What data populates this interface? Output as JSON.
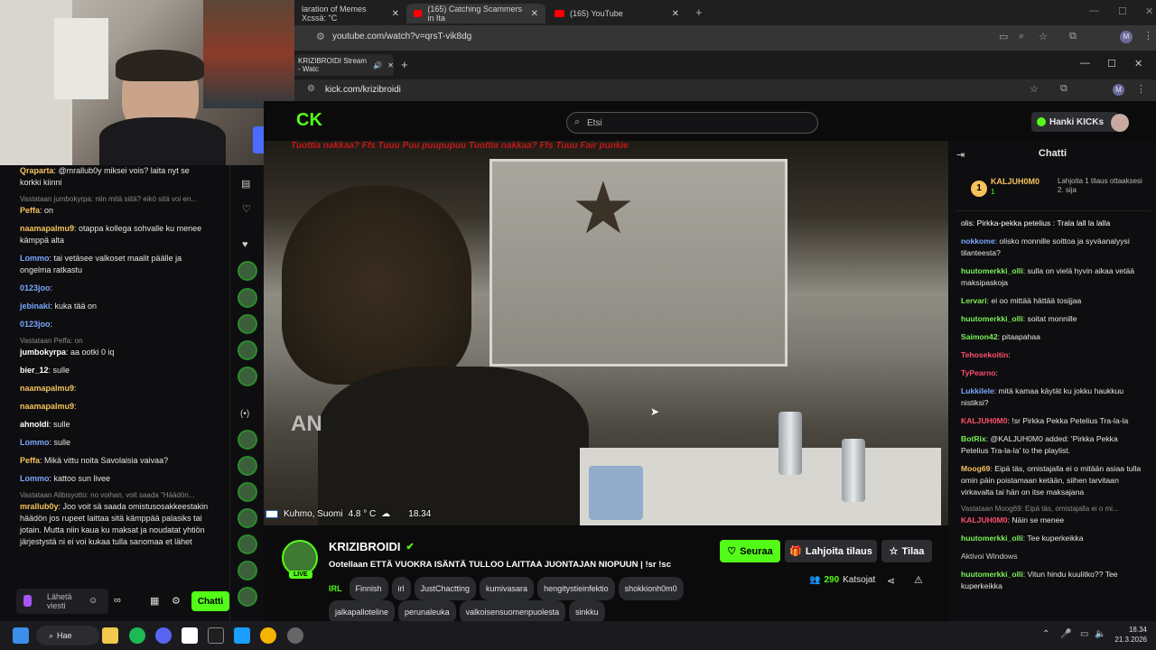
{
  "bg_browser": {
    "tabs": [
      {
        "label": "laration of Memes Xcssä: \"C"
      },
      {
        "label": "(165) Catching Scammers in Ita"
      },
      {
        "label": "(165) YouTube"
      }
    ],
    "url": "youtube.com/watch?v=qrsT-vik8dg"
  },
  "left_chat": {
    "top_msg": {
      "user": "Qraparta",
      "text": ": @mrallub0y miksei vois? laita nyt se korkki kiinni"
    },
    "messages": [
      {
        "reply": "Vastataan jumbokyrpa: niin mitä siitä? eikö sitä voi en...",
        "user": "Peffa",
        "text": ": on",
        "color": "#f5c25b"
      },
      {
        "user": "naamapalmu9",
        "text": ": otappa kollega sohvalle ku menee kämppä alta",
        "color": "#f5c25b"
      },
      {
        "user": "Lommo",
        "text": ": tai vetäsee valkoset maalit päälle ja ongelma ratkastu",
        "color": "#7aa7ff"
      },
      {
        "user": "0123joo",
        "text": ":",
        "color": "#7aa7ff"
      },
      {
        "user": "jebinaki",
        "text": ": kuka tää on",
        "color": "#7aa7ff"
      },
      {
        "user": "0123joo",
        "text": ":",
        "color": "#7aa7ff"
      },
      {
        "reply": "Vastataan Peffa: on",
        "user": "jumbokyrpa",
        "text": ": aa ootki 0 iq",
        "color": "#ffffff"
      },
      {
        "user": "bier_12",
        "text": ": sulle",
        "color": "#ffffff"
      },
      {
        "user": "naamapalmu9",
        "text": ":",
        "color": "#f5c25b"
      },
      {
        "user": "naamapalmu9",
        "text": ":",
        "color": "#f5c25b"
      },
      {
        "user": "ahnoldi",
        "text": ": sulle",
        "color": "#ffffff"
      },
      {
        "user": "Lommo",
        "text": ": sulle",
        "color": "#7aa7ff"
      },
      {
        "user": "Peffa",
        "text": ": Mikä vittu noita Savolaisia vaivaa?",
        "color": "#f5c25b"
      },
      {
        "user": "Lommo",
        "text": ": kattoo sun livee",
        "color": "#7aa7ff"
      },
      {
        "reply": "Vastataan Alibisyotto: no voihan, voit saada \"Häädön...",
        "user": "mrallub0y",
        "text": ": Joo voit sä saada omistusosakkeestakin häädön jos rupeet laittaa sitä kämppää palasiks tai jotain. Mutta niin kaua ku maksat ja noudatat yhtiön järjestystä ni ei voi kukaa tulla sanomaa et lähet",
        "color": "#f5c25b"
      }
    ],
    "input_placeholder": "Lähetä viesti",
    "chat_button": "Chatti"
  },
  "kick": {
    "tab_title": "KRIZIBROIDI Stream - Watc",
    "url": "kick.com/krizibroidi",
    "search_placeholder": "Etsi",
    "get_kicks": "Hanki KICKs",
    "ticker": "Tuottia nakkaa?   Ffs   Tuuu   Puu puupupuu   Tuottia nakkaa?   Ffs   Tuuu   Fair punkie",
    "overlay": {
      "location": "Kuhmo, Suomi",
      "temp": "4.8 ° C",
      "time": "18.34"
    },
    "streamer": "KRIZIBROIDI",
    "live_badge": "LIVE",
    "stream_title": "Ootellaan ETTÄ VUOKRA ISÄNTÄ TULLOO LAITTAA JUONTAJAN NIOPUUN | !sr !sc",
    "category": "IRL",
    "tags": [
      "Finnish",
      "irl",
      "JustChactting",
      "kumivasara",
      "hengitystieinfektio",
      "shokkionh0m0",
      "jalkapalloteline",
      "perunaleuka",
      "valkoisensuomenpuolesta",
      "sinkku"
    ],
    "follow": "Seuraa",
    "gift": "Lahjoita tilaus",
    "subscribe": "Tilaa",
    "viewers": "290",
    "viewers_label": "Katsojat"
  },
  "right_chat": {
    "title": "Chatti",
    "leader": {
      "rank": "1",
      "name": "KALJUH0M0",
      "count": "1",
      "note": "Lahjoita 1 tilaus ottaaksesi 2. sija"
    },
    "messages": [
      {
        "user": "",
        "text": "olis: Pirkka-pekka petelius : Trala lall la lalla",
        "color": "#ffffff"
      },
      {
        "user": "nokkome",
        "text": ": olisko monnille soittoa ja syväanalyysi tilanteesta?",
        "color": "#7aa7ff"
      },
      {
        "user": "huutomerkki_olli",
        "text": ": sulla on vielä hyvin aikaa vetää maksipaskoja",
        "color": "#7cf05a"
      },
      {
        "user": "Lervari",
        "text": ": ei oo mittää hättää tosijjaa",
        "color": "#7cf05a"
      },
      {
        "user": "huutomerkki_olli",
        "text": ": soitat monnille",
        "color": "#7cf05a"
      },
      {
        "user": "Saimon42",
        "text": ": pitaapahaa",
        "color": "#7cf05a"
      },
      {
        "user": "Tehosekoitin",
        "text": ":",
        "color": "#ff4d6d"
      },
      {
        "user": "TyPearno",
        "text": ":",
        "color": "#ff4d6d"
      },
      {
        "user": "Lukkilele",
        "text": ": mitä kamaa käytät ku jokku haukkuu nistiksi?",
        "color": "#7aa7ff"
      },
      {
        "user": "KALJUH0M0",
        "text": ": !sr Pirkka Pekka Petelius Tra-la-la",
        "color": "#ff4d6d"
      },
      {
        "user": "BotRix",
        "text": ": @KALJUH0M0 added: 'Pirkka Pekka Petelius Tra-la-la' to the playlist.",
        "color": "#7cf05a"
      },
      {
        "user": "Moog69",
        "text": ": Eipä täs, omistajalla ei o mitään asiaa tulla omin päin poistamaan ketään, siihen tarvitaan virkavalta tai hän on itse maksajana",
        "color": "#f5c25b"
      },
      {
        "reply": "Vastataan Moog69: Eipä täs, omistajalla ei o mi...",
        "user": "KALJUH0M0",
        "text": ": Näin se menee",
        "color": "#ff4d6d"
      },
      {
        "user": "huutomerkki_olli",
        "text": ": Tee kuperkeikka",
        "color": "#7cf05a"
      },
      {
        "user": "",
        "text": "Aktivoi Windows",
        "color": "#cfcfcf"
      },
      {
        "user": "huutomerkki_olli",
        "text": ": Vitun hindu kuulitko?? Tee kuperkeikka",
        "color": "#7cf05a"
      }
    ]
  },
  "taskbar": {
    "search": "Hae",
    "time": "18.34",
    "date": "21.3.2026"
  }
}
